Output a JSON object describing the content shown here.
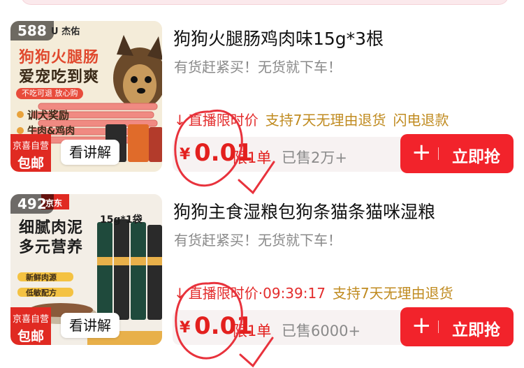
{
  "products": [
    {
      "sales_badge": "588",
      "brand": "U 杰佑",
      "image_headline_1": "狗狗火腿肠",
      "image_headline_2": "爱宠吃到爽",
      "image_tagline": "不吃可退 放心购",
      "image_feature_1": "训犬奖励",
      "image_feature_2": "牛肉&鸡肉",
      "jd_tag_line1": "京喜自营",
      "jd_tag_line2": "包邮",
      "explain_label": "看讲解",
      "title": "狗狗火腿肠鸡肉味15g*3根",
      "subtitle": "有货赶紧买！无货就下车！",
      "promo_arrow": "↓",
      "promo_live": "直播限时价",
      "promo_timer": "",
      "promo_support": "支持7天无理由退货",
      "promo_flash": "闪电退款",
      "price_symbol": "¥",
      "price_value": "0.01",
      "limit_label": "限1单",
      "sold_label": "已售2万+",
      "buy_plus": "+",
      "buy_label": "立即抢"
    },
    {
      "sales_badge": "492",
      "brand": "京东",
      "image_headline_1": "细腻肉泥",
      "image_headline_2": "多元营养",
      "image_tagline": "15g*1袋",
      "image_feature_1": "新鲜肉源",
      "image_feature_2": "低敏配方",
      "jd_tag_line1": "京喜自营",
      "jd_tag_line2": "包邮",
      "explain_label": "看讲解",
      "title": "狗狗主食湿粮包狗条猫条猫咪湿粮",
      "subtitle": "有货赶紧买！无货就下车！",
      "promo_arrow": "↓",
      "promo_live": "直播限时价",
      "promo_timer": "·09:39:17",
      "promo_support": "支持7天无理由退货",
      "promo_flash": "",
      "price_symbol": "¥",
      "price_value": "0.01",
      "limit_label": "限1单",
      "sold_label": "已售6000+",
      "buy_plus": "+",
      "buy_label": "立即抢"
    }
  ],
  "colors": {
    "accent_red": "#e3201e",
    "button_red": "#f2232b",
    "support_gold": "#c08b20",
    "annotation_red": "#e8323c"
  },
  "icons": [
    "red-down-arrow-icon",
    "plus-icon",
    "hand-drawn-circle-annotation",
    "hand-drawn-check-annotation"
  ]
}
